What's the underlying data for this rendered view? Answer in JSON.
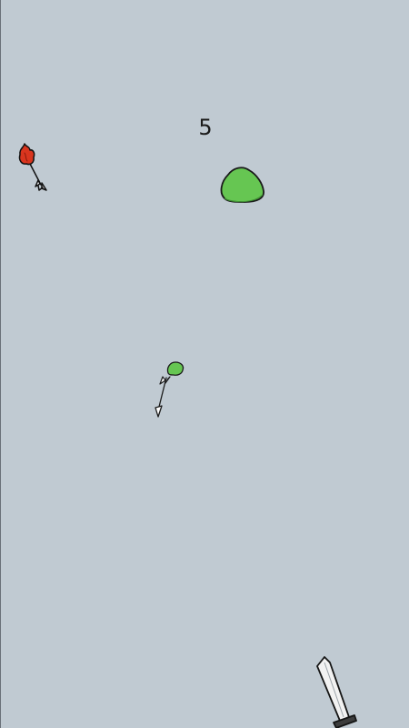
{
  "game": {
    "background_color": "#c0cad2",
    "score": "5"
  },
  "sprites": {
    "fire_arrow": {
      "icon": "fire-arrow-icon",
      "head_color": "#d9351e"
    },
    "big_slime": {
      "icon": "slime-icon",
      "color": "#66c652"
    },
    "small_slime": {
      "icon": "slime-icon",
      "color": "#66c652"
    },
    "small_arrow": {
      "icon": "arrow-icon"
    },
    "sword": {
      "icon": "sword-icon",
      "blade_color": "#f2f2f2",
      "hilt_color": "#3d3d3d"
    }
  }
}
